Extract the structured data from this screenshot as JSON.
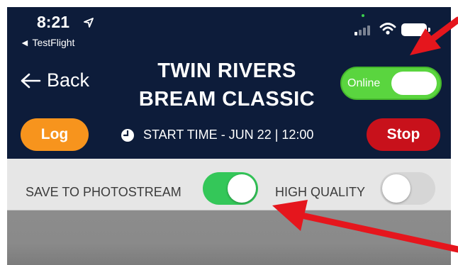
{
  "status_bar": {
    "time": "8:21",
    "back_app": "◄ TestFlight",
    "location_icon": "location-arrow-icon",
    "signal_icon": "cellular-signal-icon",
    "wifi_icon": "wifi-icon",
    "battery_icon": "battery-icon"
  },
  "header": {
    "back_label": "Back",
    "title_line1": "TWIN RIVERS",
    "title_line2": "BREAM CLASSIC",
    "online_label": "Online",
    "online_state": true
  },
  "controls": {
    "log_label": "Log",
    "start_time": "START TIME - JUN 22 | 12:00",
    "stop_label": "Stop"
  },
  "settings": {
    "save_label": "SAVE TO PHOTOSTREAM",
    "save_state": true,
    "hq_label": "HIGH QUALITY",
    "hq_state": false
  },
  "colors": {
    "header_bg": "#0d1c3a",
    "log": "#f7941d",
    "stop": "#c8111b",
    "toggle_on": "#34c759",
    "annotation_arrow": "#e5161d"
  }
}
